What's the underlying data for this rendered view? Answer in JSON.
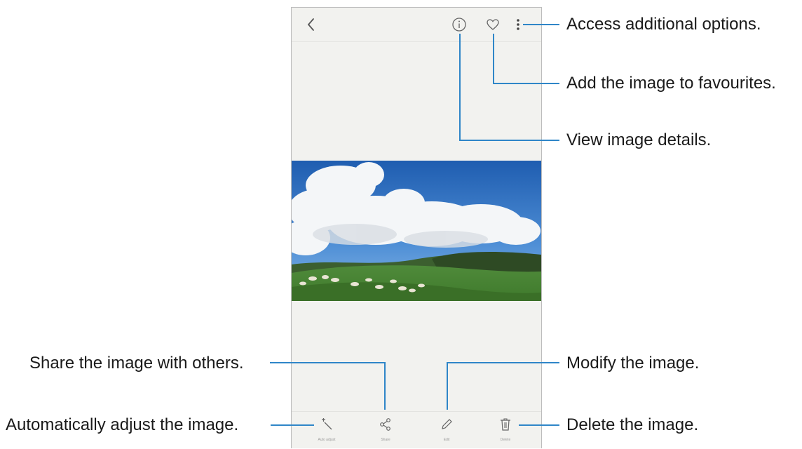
{
  "toolbar": {
    "back_icon": "chevron-left-icon",
    "details_icon": "info-icon",
    "favourite_icon": "heart-icon",
    "more_icon": "more-vertical-icon"
  },
  "bottom_bar": {
    "items": [
      {
        "label": "Auto adjust",
        "icon": "magic-wand-icon"
      },
      {
        "label": "Share",
        "icon": "share-icon"
      },
      {
        "label": "Edit",
        "icon": "pencil-icon"
      },
      {
        "label": "Delete",
        "icon": "trash-icon"
      }
    ]
  },
  "callouts": {
    "more_options": "Access additional options.",
    "favourites": "Add the image to favourites.",
    "details": "View image details.",
    "share": "Share the image with others.",
    "modify": "Modify the image.",
    "auto_adjust": "Automatically adjust the image.",
    "delete": "Delete the image."
  },
  "colors": {
    "callout_line": "#2f86c8",
    "phone_background": "#f2f2ef"
  }
}
